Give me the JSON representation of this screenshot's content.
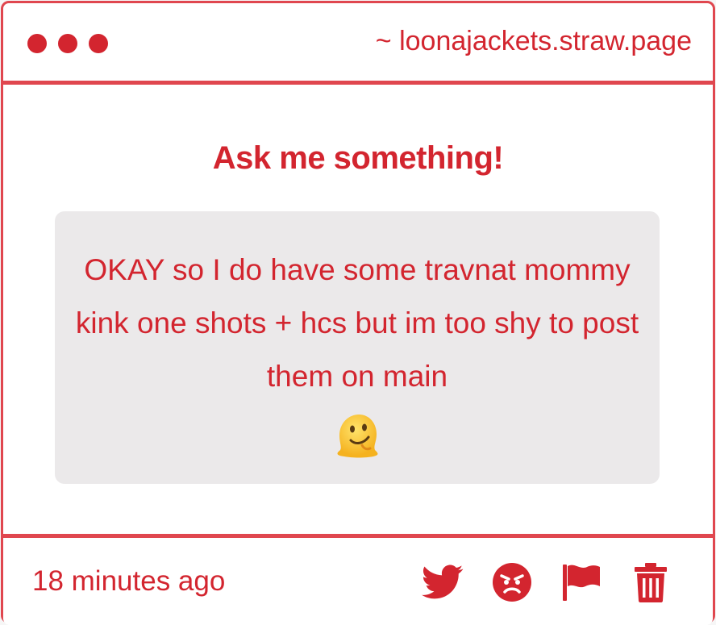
{
  "window": {
    "site_url": "~ loonajackets.straw.page"
  },
  "main": {
    "heading": "Ask me something!",
    "question": "OKAY so I do have some travnat mommy kink one shots + hcs but im too shy to post them on main",
    "question_emoji": "melting-face-emoji"
  },
  "footer": {
    "timestamp": "18 minutes ago",
    "actions": [
      {
        "icon": "twitter-icon"
      },
      {
        "icon": "angry-face-icon"
      },
      {
        "icon": "flag-icon"
      },
      {
        "icon": "trash-icon"
      }
    ]
  },
  "colors": {
    "accent": "#d3252f",
    "border": "#e0474f",
    "question_bg": "#ebe9ea"
  }
}
